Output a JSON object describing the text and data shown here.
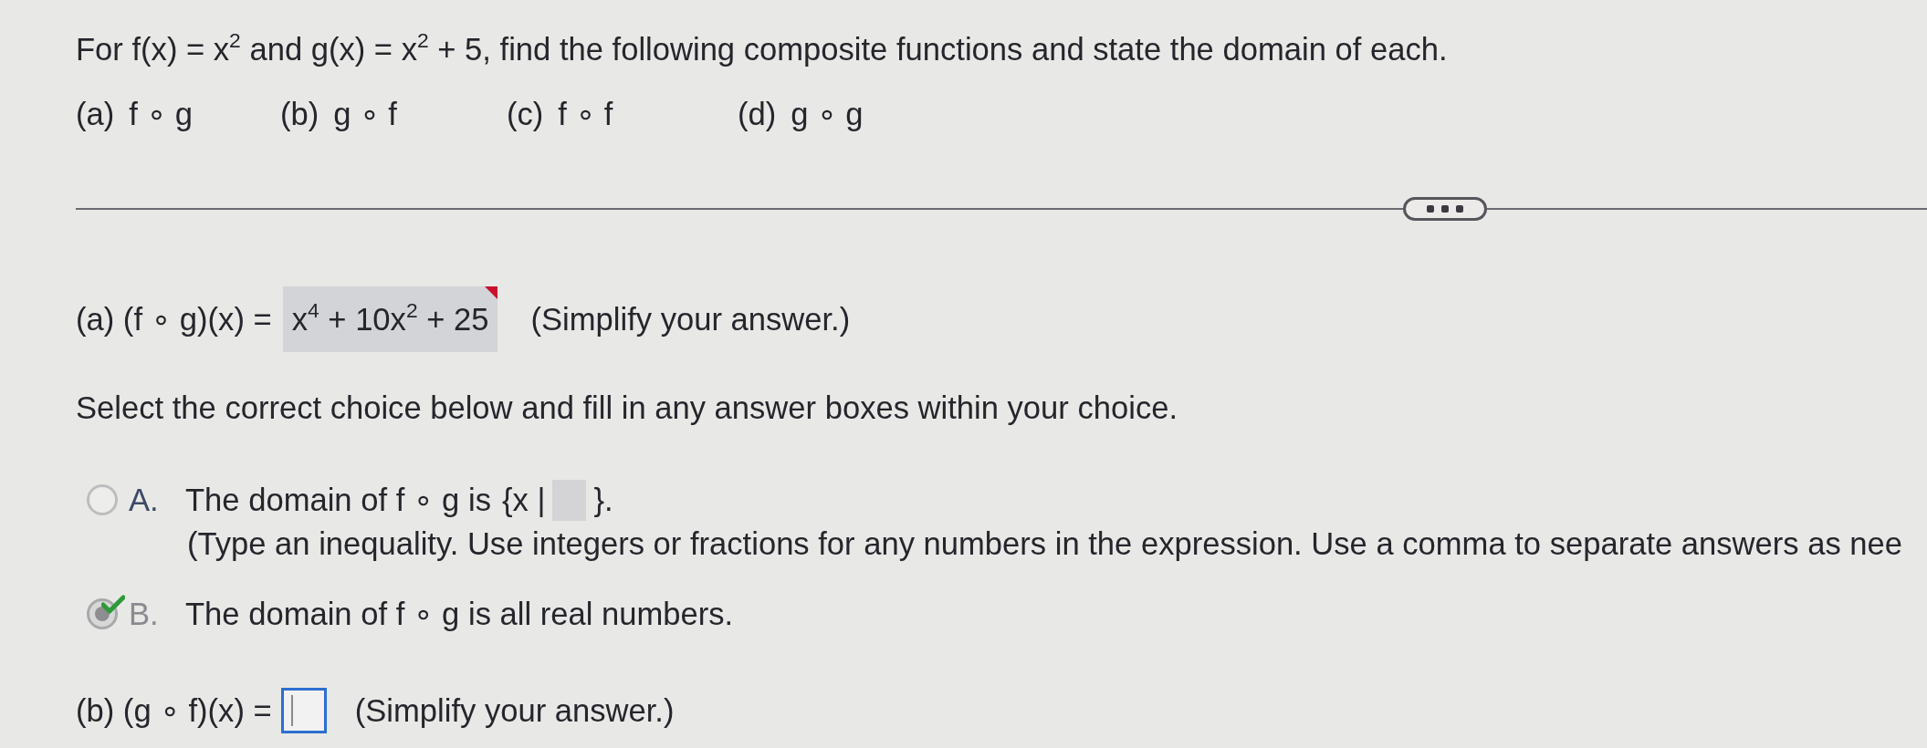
{
  "problem": {
    "statement": "For f(x) = x$^{2}$ and g(x) = x$^{2}$ + 5, find the following composite functions and state the domain of each.",
    "parts": [
      {
        "label": "(a)",
        "expression": "f ∘ g"
      },
      {
        "label": "(b)",
        "expression": "g ∘ f"
      },
      {
        "label": "(c)",
        "expression": "f ∘ f"
      },
      {
        "label": "(d)",
        "expression": "g ∘ g"
      }
    ]
  },
  "part_a": {
    "prompt": "(a) (f ∘ g)(x) =",
    "answer": "x$^{4}$ + 10x$^{2}$ + 25",
    "flagged": true,
    "hint": "(Simplify your answer.)"
  },
  "instruction": "Select the correct choice below and fill in any answer boxes within your choice.",
  "choices": [
    {
      "kind": "set_builder",
      "letter": "A.",
      "selected": false,
      "correct": false,
      "text": "The domain of f ∘ g is",
      "set_open": "{x |",
      "set_close": "}.",
      "hint": "(Type an inequality. Use integers or fractions for any numbers in the expression. Use a comma to separate answers as nee"
    },
    {
      "kind": "statement",
      "letter": "B.",
      "selected": true,
      "correct": true,
      "text": "The domain of f ∘ g is all real numbers."
    }
  ],
  "part_b": {
    "prompt": "(b) (g ∘ f)(x) =",
    "focused": true,
    "hint": "(Simplify your answer.)"
  }
}
